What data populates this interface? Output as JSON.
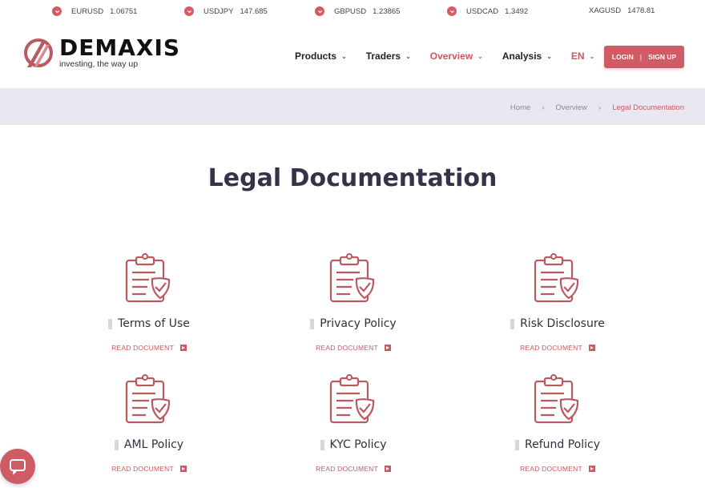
{
  "ticker": [
    {
      "symbol": "EURUSD",
      "value": "1.06751",
      "arrow": true
    },
    {
      "symbol": "USDJPY",
      "value": "147.685",
      "arrow": true
    },
    {
      "symbol": "GBPUSD",
      "value": "1.23865",
      "arrow": true
    },
    {
      "symbol": "USDCAD",
      "value": "1.3492",
      "arrow": true
    },
    {
      "symbol": "XAGUSD",
      "value": "1478.81",
      "arrow": false
    }
  ],
  "brand": {
    "name": "DEMAXIS",
    "tagline": "investing, the way up",
    "accent": "#cf5c64"
  },
  "nav": [
    {
      "label": "Products",
      "active": false
    },
    {
      "label": "Traders",
      "active": false
    },
    {
      "label": "Overview",
      "active": true
    },
    {
      "label": "Analysis",
      "active": false
    },
    {
      "label": "EN",
      "active": false
    }
  ],
  "auth": {
    "login": "LOGIN",
    "separator": "|",
    "signup": "SIGN UP"
  },
  "breadcrumb": {
    "home": "Home",
    "section": "Overview",
    "current": "Legal Documentation"
  },
  "page": {
    "title": "Legal Documentation"
  },
  "documents": [
    {
      "title": "Terms of Use",
      "link": "READ DOCUMENT"
    },
    {
      "title": "Privacy Policy",
      "link": "READ DOCUMENT"
    },
    {
      "title": "Risk Disclosure",
      "link": "READ DOCUMENT"
    },
    {
      "title": "AML Policy",
      "link": "READ DOCUMENT"
    },
    {
      "title": "KYC Policy",
      "link": "READ DOCUMENT"
    },
    {
      "title": "Refund Policy",
      "link": "READ DOCUMENT"
    }
  ],
  "icons": {
    "document": "clipboard-check-icon",
    "chat": "chat-bubble-icon",
    "ticker_down": "chevron-down-icon"
  }
}
